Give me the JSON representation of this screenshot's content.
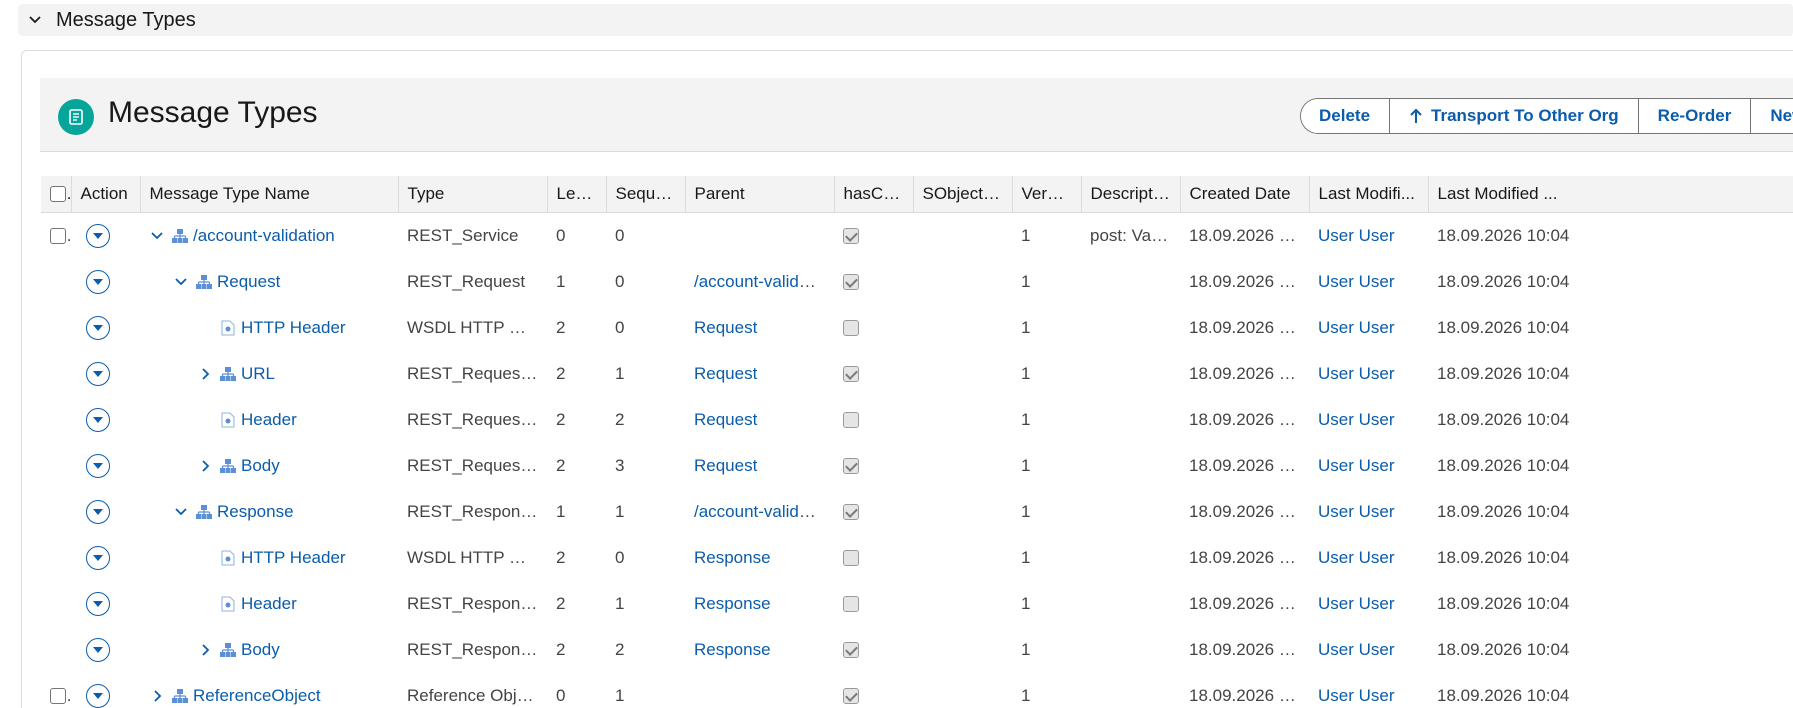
{
  "section": {
    "title": "Message Types"
  },
  "header": {
    "title": "Message Types"
  },
  "buttons": [
    {
      "label": "Delete",
      "icon": ""
    },
    {
      "label": "Transport To Other Org",
      "icon": "arrow-up-icon"
    },
    {
      "label": "Re-Order",
      "icon": ""
    },
    {
      "label": "New",
      "icon": ""
    }
  ],
  "columns": [
    "Action",
    "Message Type Name",
    "Type",
    "Level",
    "Seque...",
    "Parent",
    "hasChild",
    "SObjectT...",
    "Versi...",
    "Descripti...",
    "Created Date",
    "Last Modifi...",
    "Last Modified ..."
  ],
  "rows": [
    {
      "selectable": true,
      "indent": 0,
      "toggle": "expanded",
      "icon": "hierarchy-icon",
      "name": "/account-validation",
      "type": "REST_Service",
      "level": "0",
      "sequence": "0",
      "parent": "",
      "has_child": true,
      "sobject_type": "",
      "version": "1",
      "description": "post: Vali...",
      "created_date": "18.09.2026 1...",
      "last_modified_by": "User User",
      "last_modified_date": "18.09.2026 10:04"
    },
    {
      "selectable": false,
      "indent": 1,
      "toggle": "expanded",
      "icon": "hierarchy-icon",
      "name": "Request",
      "type": "REST_Request",
      "level": "1",
      "sequence": "0",
      "parent": "/account-validati...",
      "has_child": true,
      "sobject_type": "",
      "version": "1",
      "description": "",
      "created_date": "18.09.2026 1...",
      "last_modified_by": "User User",
      "last_modified_date": "18.09.2026 10:04"
    },
    {
      "selectable": false,
      "indent": 2,
      "toggle": "none",
      "icon": "document-icon",
      "name": "HTTP Header",
      "type": "WSDL HTTP Hea...",
      "level": "2",
      "sequence": "0",
      "parent": "Request",
      "has_child": false,
      "sobject_type": "",
      "version": "1",
      "description": "",
      "created_date": "18.09.2026 1...",
      "last_modified_by": "User User",
      "last_modified_date": "18.09.2026 10:04"
    },
    {
      "selectable": false,
      "indent": 2,
      "toggle": "collapsed",
      "icon": "hierarchy-icon",
      "name": "URL",
      "type": "REST_Request_...",
      "level": "2",
      "sequence": "1",
      "parent": "Request",
      "has_child": true,
      "sobject_type": "",
      "version": "1",
      "description": "",
      "created_date": "18.09.2026 1...",
      "last_modified_by": "User User",
      "last_modified_date": "18.09.2026 10:04"
    },
    {
      "selectable": false,
      "indent": 2,
      "toggle": "none",
      "icon": "document-icon",
      "name": "Header",
      "type": "REST_Request_...",
      "level": "2",
      "sequence": "2",
      "parent": "Request",
      "has_child": false,
      "sobject_type": "",
      "version": "1",
      "description": "",
      "created_date": "18.09.2026 1...",
      "last_modified_by": "User User",
      "last_modified_date": "18.09.2026 10:04"
    },
    {
      "selectable": false,
      "indent": 2,
      "toggle": "collapsed",
      "icon": "hierarchy-icon",
      "name": "Body",
      "type": "REST_Request_...",
      "level": "2",
      "sequence": "3",
      "parent": "Request",
      "has_child": true,
      "sobject_type": "",
      "version": "1",
      "description": "",
      "created_date": "18.09.2026 1...",
      "last_modified_by": "User User",
      "last_modified_date": "18.09.2026 10:04"
    },
    {
      "selectable": false,
      "indent": 1,
      "toggle": "expanded",
      "icon": "hierarchy-icon",
      "name": "Response",
      "type": "REST_Response",
      "level": "1",
      "sequence": "1",
      "parent": "/account-validati...",
      "has_child": true,
      "sobject_type": "",
      "version": "1",
      "description": "",
      "created_date": "18.09.2026 1...",
      "last_modified_by": "User User",
      "last_modified_date": "18.09.2026 10:04"
    },
    {
      "selectable": false,
      "indent": 2,
      "toggle": "none",
      "icon": "document-icon",
      "name": "HTTP Header",
      "type": "WSDL HTTP Hea...",
      "level": "2",
      "sequence": "0",
      "parent": "Response",
      "has_child": false,
      "sobject_type": "",
      "version": "1",
      "description": "",
      "created_date": "18.09.2026 1...",
      "last_modified_by": "User User",
      "last_modified_date": "18.09.2026 10:04"
    },
    {
      "selectable": false,
      "indent": 2,
      "toggle": "none",
      "icon": "document-icon",
      "name": "Header",
      "type": "REST_Response...",
      "level": "2",
      "sequence": "1",
      "parent": "Response",
      "has_child": false,
      "sobject_type": "",
      "version": "1",
      "description": "",
      "created_date": "18.09.2026 1...",
      "last_modified_by": "User User",
      "last_modified_date": "18.09.2026 10:04"
    },
    {
      "selectable": false,
      "indent": 2,
      "toggle": "collapsed",
      "icon": "hierarchy-icon",
      "name": "Body",
      "type": "REST_Response...",
      "level": "2",
      "sequence": "2",
      "parent": "Response",
      "has_child": true,
      "sobject_type": "",
      "version": "1",
      "description": "",
      "created_date": "18.09.2026 1...",
      "last_modified_by": "User User",
      "last_modified_date": "18.09.2026 10:04"
    },
    {
      "selectable": true,
      "indent": 0,
      "toggle": "collapsed",
      "icon": "hierarchy-icon",
      "name": "ReferenceObject",
      "type": "Reference Object",
      "level": "0",
      "sequence": "1",
      "parent": "",
      "has_child": true,
      "sobject_type": "",
      "version": "1",
      "description": "",
      "created_date": "18.09.2026 1...",
      "last_modified_by": "User User",
      "last_modified_date": "18.09.2026 10:04"
    }
  ],
  "colors": {
    "accent": "#0b5cab",
    "object_icon": "#06a59a",
    "header_bg": "#f3f3f3"
  }
}
